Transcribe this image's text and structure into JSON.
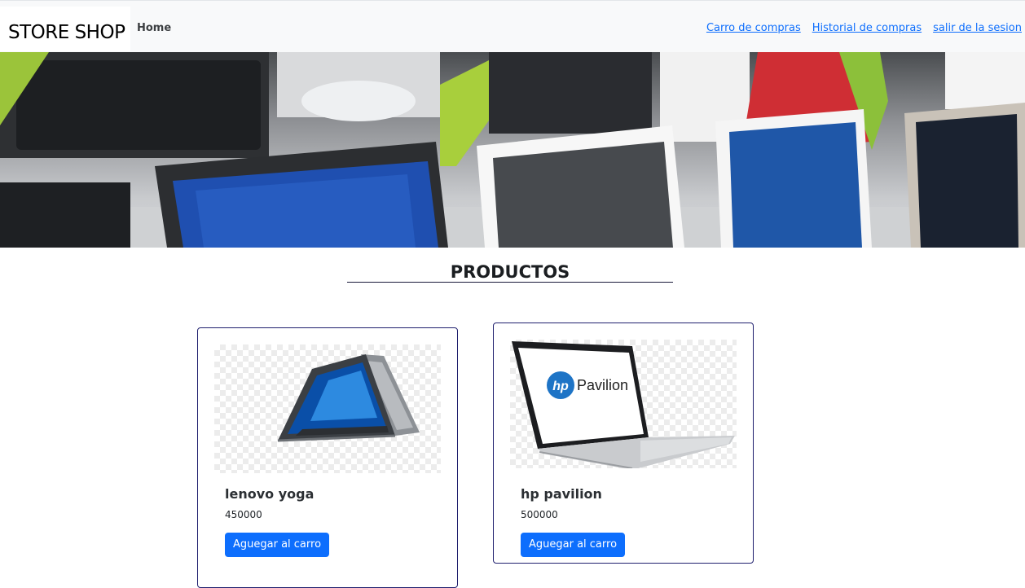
{
  "navbar": {
    "brand": "STORE SHOP",
    "home": "Home",
    "links": [
      "Carro de compras",
      "Historial de compras",
      "salir de la sesion"
    ]
  },
  "section": {
    "title": "PRODUCTOS"
  },
  "products": [
    {
      "name": "lenovo yoga",
      "price": "450000",
      "button": "Aguegar al carro"
    },
    {
      "name": "hp pavilion",
      "price": "500000",
      "button": "Aguegar al carro",
      "logo_text": "Pavilion",
      "logo_mark": "hp"
    }
  ],
  "colors": {
    "accent": "#0d6efd",
    "navbar_bg": "#f8f9fa",
    "card_border": "#1f1f6e"
  }
}
